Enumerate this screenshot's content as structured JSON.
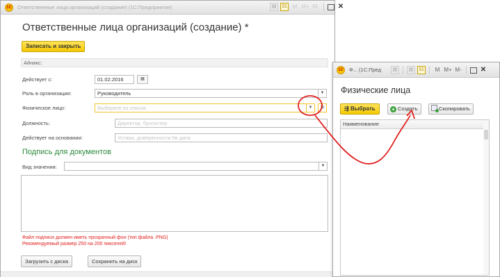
{
  "window1": {
    "title": "Ответственные лица организаций (создание)  (1С:Предприятие)",
    "form_title": "Ответственные лица организаций (создание) *",
    "save_button": "Записать и закрыть",
    "org_name": "Айникс:",
    "fields": {
      "valid_from_label": "Действует с:",
      "valid_from_value": "01.02.2016",
      "role_label": "Роль в организации:",
      "role_value": "Руководитель",
      "person_label": "Физическое лицо:",
      "person_placeholder": "Выберите из списка",
      "position_label": "Должность:",
      "position_placeholder": "Директор, бухгалтер",
      "basis_label": "Действует на основании:",
      "basis_placeholder": "Устава, доверенности № дата"
    },
    "section_title": "Подпись для документов",
    "value_type_label": "Вид значения:",
    "note_line1": "Файл подписи должен иметь прозрачный фон (тип файла .PNG)",
    "note_line2": "Рекомендуемый размер 250 на 200 пикселей!",
    "load_button": "Загрузить с диска",
    "save_disk_button": "Сохранить на диск",
    "title_buttons": [
      "M",
      "M+",
      "M-"
    ]
  },
  "window2": {
    "title": "Ф... (1С:Пред",
    "form_title": "Физические лица",
    "choose_button": "Выбрать",
    "create_button": "Создать",
    "copy_button": "Скопировать",
    "column_header": "Наименование",
    "title_buttons": [
      "M",
      "M+",
      "M-"
    ]
  },
  "colors": {
    "accent_yellow": "#f5c900",
    "section_green": "#2a8a3a",
    "note_red": "#e02020",
    "annotation_red": "#e0201e"
  }
}
